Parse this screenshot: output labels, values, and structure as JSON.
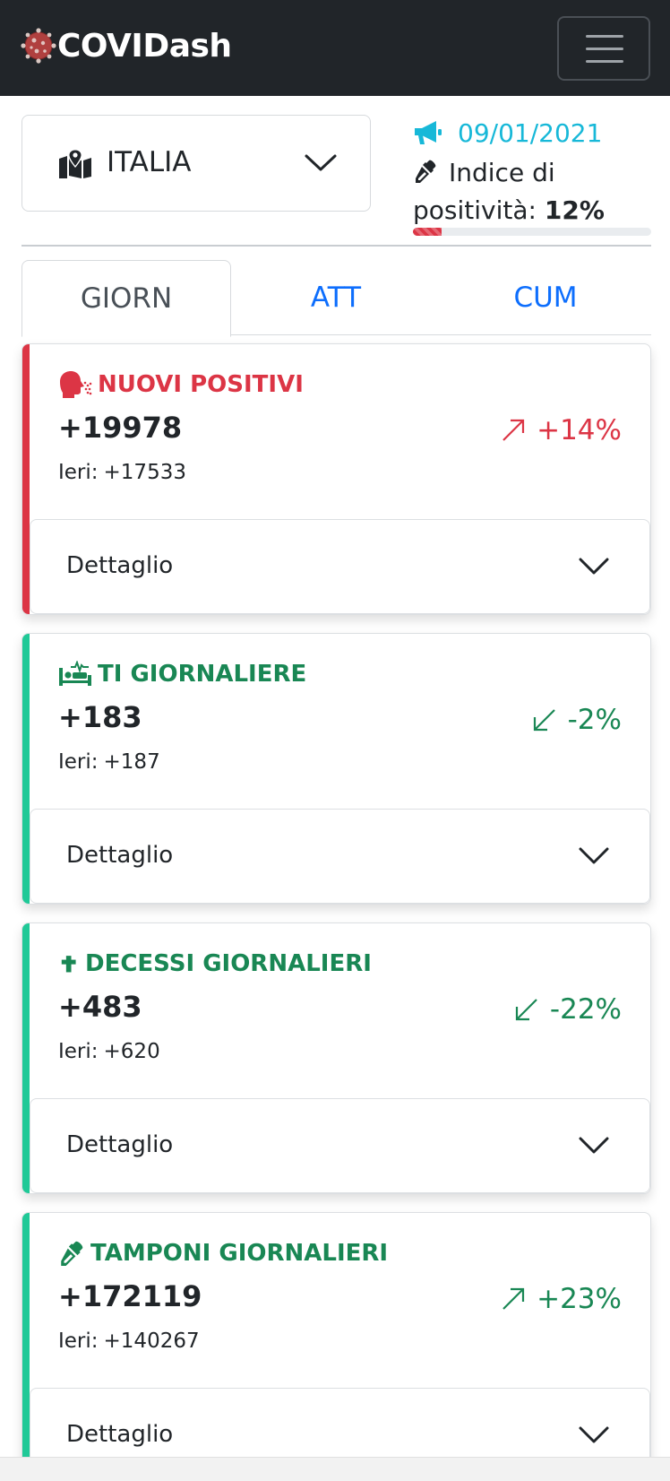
{
  "navbar": {
    "brand": "COVIDash",
    "menu_icon": "hamburger-menu-icon"
  },
  "region": {
    "label": "ITALIA",
    "icon": "map-marked-icon"
  },
  "info": {
    "date": "09/01/2021",
    "index_label": "Indice di positività:",
    "index_value": "12%",
    "progress_fraction": 0.12,
    "date_color": "#17b8d8"
  },
  "tabs": [
    {
      "label": "GIORN",
      "active": true
    },
    {
      "label": "ATT",
      "active": false
    },
    {
      "label": "CUM",
      "active": false
    }
  ],
  "cards": [
    {
      "title": "NUOVI POSITIVI",
      "icon": "head-cough-icon",
      "value": "+19978",
      "ieri_label": "Ieri:",
      "ieri_value": "+17533",
      "trend": "+14%",
      "trend_dir": "up",
      "color": "#dc3545",
      "detail_label": "Dettaglio"
    },
    {
      "title": "TI GIORNALIERE",
      "icon": "procedures-bed-icon",
      "value": "+183",
      "ieri_label": "Ieri:",
      "ieri_value": "+187",
      "trend": "-2%",
      "trend_dir": "down",
      "color": "#198754",
      "detail_label": "Dettaglio"
    },
    {
      "title": "DECESSI GIORNALIERI",
      "icon": "cross-icon",
      "value": "+483",
      "ieri_label": "Ieri:",
      "ieri_value": "+620",
      "trend": "-22%",
      "trend_dir": "down",
      "color": "#198754",
      "detail_label": "Dettaglio"
    },
    {
      "title": "TAMPONI GIORNALIERI",
      "icon": "eye-dropper-icon",
      "value": "+172119",
      "ieri_label": "Ieri:",
      "ieri_value": "+140267",
      "trend": "+23%",
      "trend_dir": "up",
      "color": "#198754",
      "detail_label": "Dettaglio"
    }
  ],
  "colors": {
    "accent_green": "#20c997",
    "accent_red": "#dc3545"
  }
}
